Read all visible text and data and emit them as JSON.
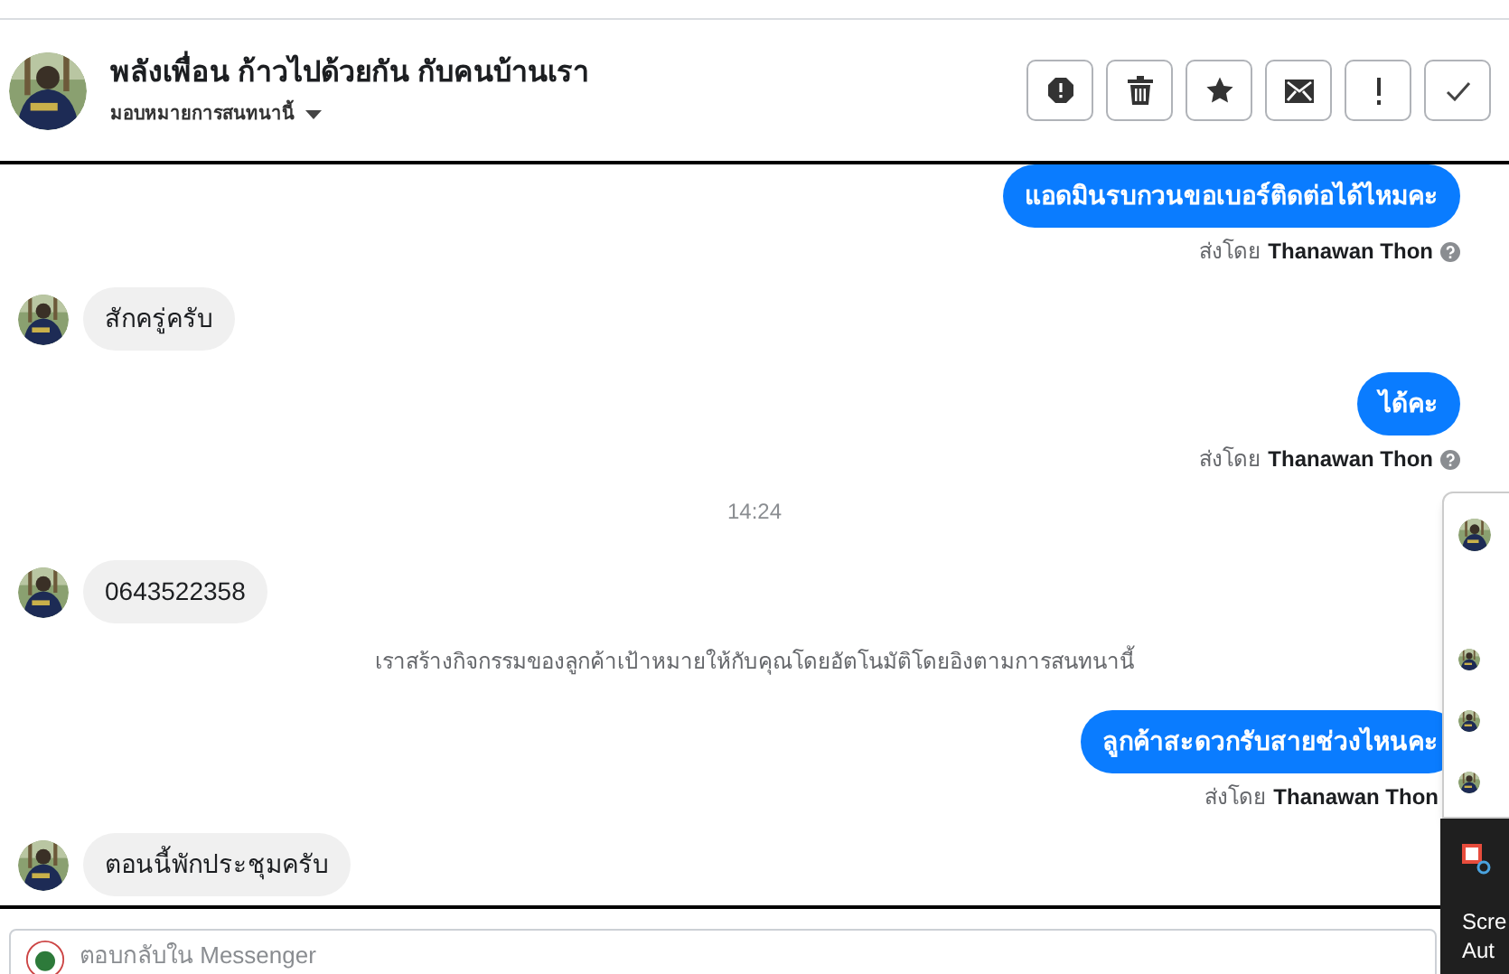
{
  "header": {
    "title": "พลังเพื่อน ก้าวไปด้วยกัน กับคนบ้านเรา",
    "assign_label": "มอบหมายการสนทนานี้"
  },
  "actions": [
    {
      "kind": "spam"
    },
    {
      "kind": "delete"
    },
    {
      "kind": "star"
    },
    {
      "kind": "unread"
    },
    {
      "kind": "important"
    },
    {
      "kind": "done"
    }
  ],
  "messages": [
    {
      "kind": "outgoing",
      "text": "แอดมินรบกวนขอเบอร์ติดต่อได้ไหมคะ",
      "sent_by_label": "ส่งโดย",
      "sender": "Thanawan Thon",
      "info_icon": true
    },
    {
      "kind": "incoming",
      "text": "สักครู่ครับ"
    },
    {
      "kind": "outgoing",
      "text": "ได้คะ",
      "sent_by_label": "ส่งโดย",
      "sender": "Thanawan Thon",
      "info_icon": true
    },
    {
      "kind": "time",
      "text": "14:24"
    },
    {
      "kind": "incoming",
      "text": "0643522358"
    },
    {
      "kind": "system",
      "text": "เราสร้างกิจกรรมของลูกค้าเป้าหมายให้กับคุณโดยอัตโนมัติโดยอิงตามการสนทนานี้"
    },
    {
      "kind": "outgoing",
      "text": "ลูกค้าสะดวกรับสายช่วงไหนคะ",
      "sent_by_label": "ส่งโดย",
      "sender": "Thanawan Thon",
      "info_icon": false
    },
    {
      "kind": "incoming",
      "text": "ตอนนี้พักประชุมครับ"
    }
  ],
  "reply": {
    "placeholder": "ตอบกลับใน Messenger"
  },
  "notification": {
    "lines": [
      "Scre",
      "Aut"
    ]
  }
}
